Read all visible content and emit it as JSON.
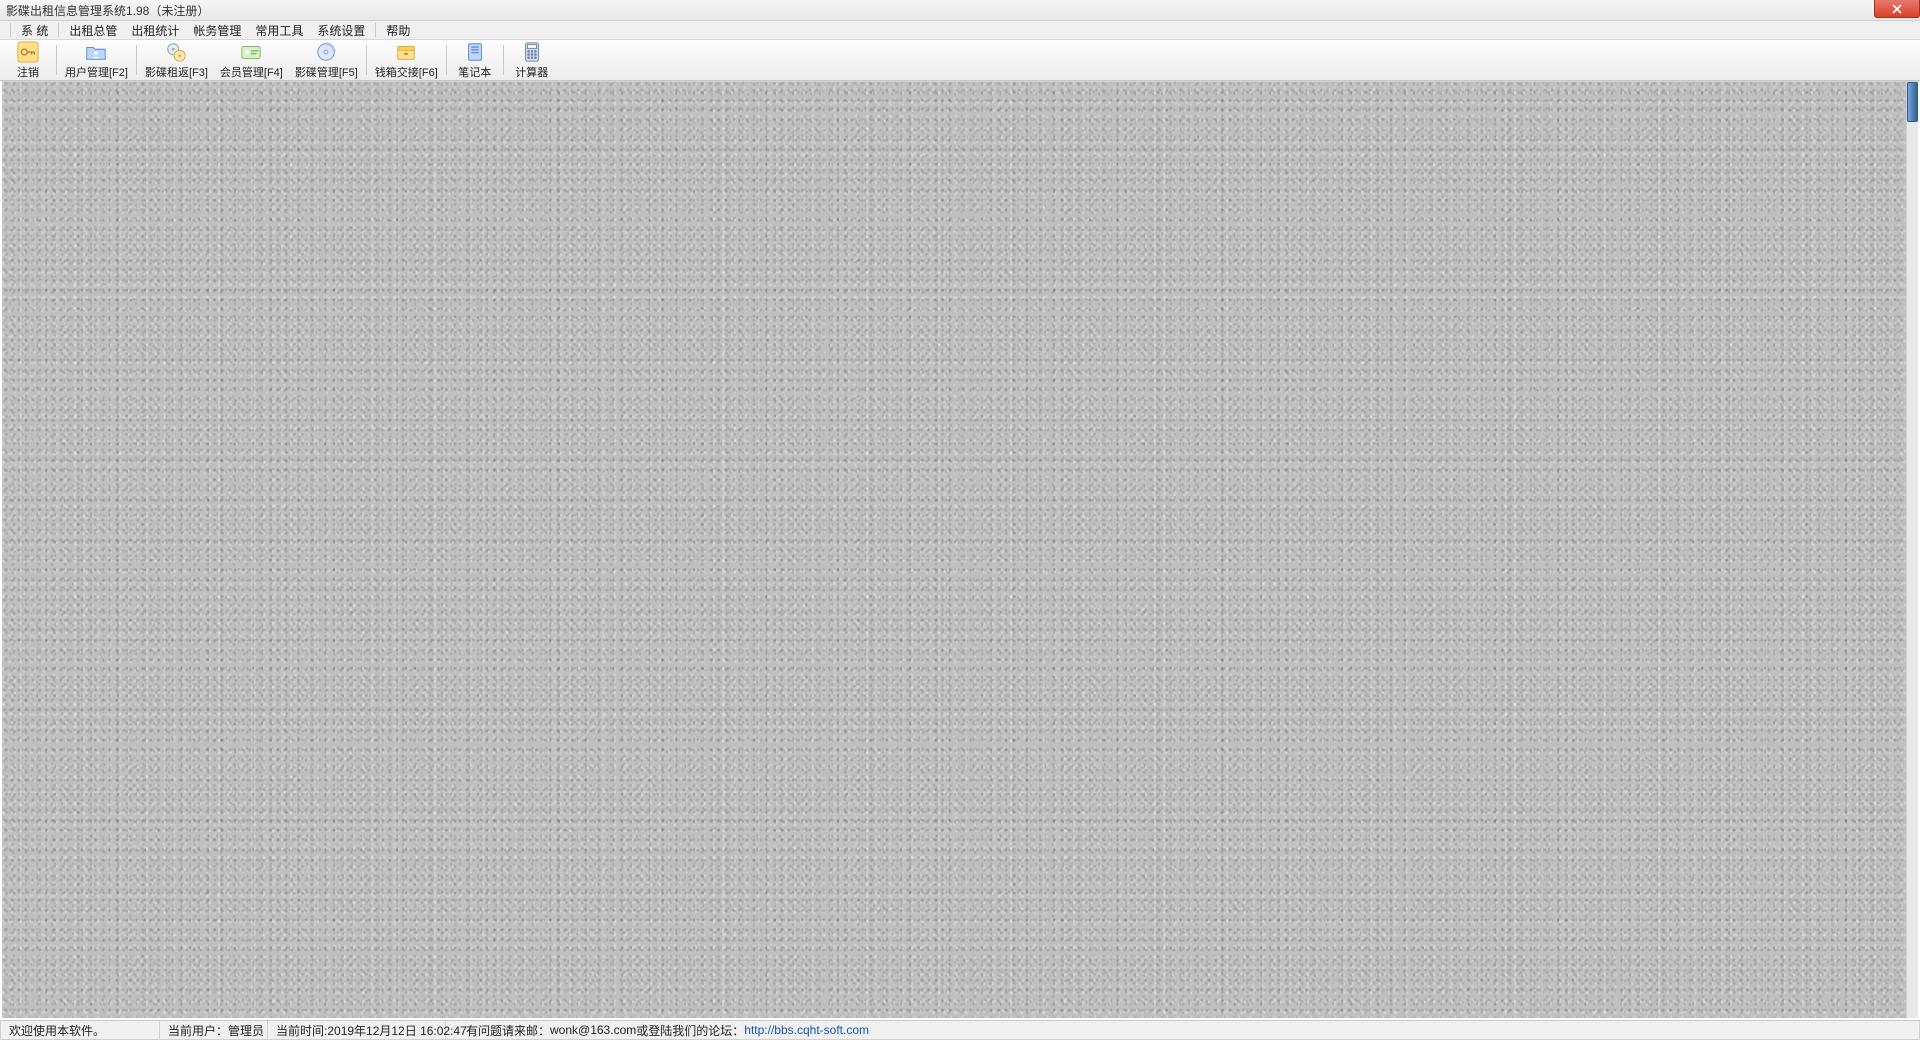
{
  "window": {
    "title": "影碟出租信息管理系统1.98（未注册）"
  },
  "menu": {
    "items": [
      {
        "label": "系  统",
        "spaced": false
      },
      {
        "label": "出租总管"
      },
      {
        "label": "出租统计"
      },
      {
        "label": "帐务管理"
      },
      {
        "label": "常用工具"
      },
      {
        "label": "系统设置"
      },
      {
        "label": "帮助"
      }
    ]
  },
  "toolbar": {
    "buttons": [
      {
        "label": "注销",
        "icon": "key-icon"
      },
      {
        "label": "用户管理[F2]",
        "icon": "folder-user-icon"
      },
      {
        "label": "影碟租返[F3]",
        "icon": "disc-swap-icon"
      },
      {
        "label": "会员管理[F4]",
        "icon": "member-card-icon"
      },
      {
        "label": "影碟管理[F5]",
        "icon": "disc-manage-icon"
      },
      {
        "label": "钱箱交接[F6]",
        "icon": "cashbox-icon"
      },
      {
        "label": "笔记本",
        "icon": "notebook-icon"
      },
      {
        "label": "计算器",
        "icon": "calculator-icon"
      }
    ],
    "separators_after": [
      0,
      1,
      4,
      5,
      6
    ]
  },
  "status": {
    "welcome": "欢迎使用本软件。",
    "user_label": "当前用户：",
    "user_value": "管理员",
    "time_label": "当前时间:",
    "time_value": "2019年12月12日  16:02:47",
    "contact_prefix": "有问题请来邮：",
    "contact_email": "wonk@163.com",
    "contact_mid": "或登陆我们的论坛：",
    "contact_url": "http://bbs.cqht-soft.com"
  },
  "icons": {
    "key-icon": "key",
    "folder-user-icon": "folder",
    "disc-swap-icon": "disc-swap",
    "member-card-icon": "card",
    "disc-manage-icon": "disc",
    "cashbox-icon": "box",
    "notebook-icon": "note",
    "calculator-icon": "calc"
  }
}
